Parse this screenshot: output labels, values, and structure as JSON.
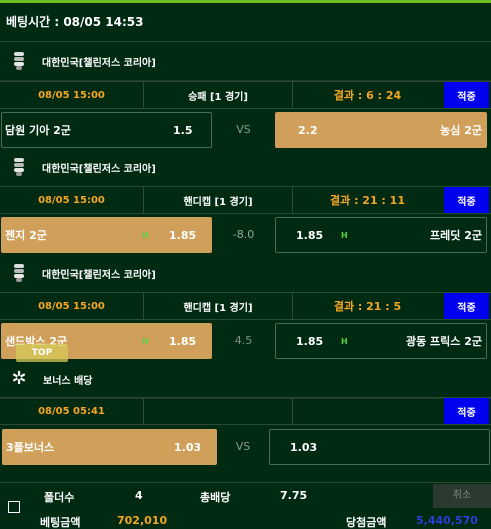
{
  "header": {
    "bet_time": "베팅시간 : 08/05 14:53"
  },
  "bets": [
    {
      "league": "대한민국[챌린저스 코리아]",
      "date": "08/05 15:00",
      "type": "승패 [1 경기]",
      "result": "결과 : 6 : 24",
      "status": "적중",
      "home": {
        "team": "담원 기아 2군",
        "odds": "1.5"
      },
      "middle": "VS",
      "away": {
        "team": "농심 2군",
        "odds": "2.2"
      }
    },
    {
      "league": "대한민국[챌린저스 코리아]",
      "date": "08/05 15:00",
      "type": "핸디캡 [1 경기]",
      "result": "결과 : 21 : 11",
      "status": "적중",
      "home": {
        "team": "젠지 2군",
        "odds": "1.85",
        "mark": "H"
      },
      "middle": "-8.0",
      "away": {
        "team": "프레딧 2군",
        "odds": "1.85",
        "mark": "H"
      }
    },
    {
      "league": "대한민국[챌린저스 코리아]",
      "date": "08/05 15:00",
      "type": "핸디캡 [1 경기]",
      "result": "결과 : 21 : 5",
      "status": "적중",
      "home": {
        "team": "샌드박스 2군",
        "odds": "1.85",
        "mark": "H"
      },
      "middle": "4.5",
      "away": {
        "team": "광동 프릭스 2군",
        "odds": "1.85",
        "mark": "H"
      }
    },
    {
      "league": "보너스 배당",
      "date": "08/05 05:41",
      "type": "",
      "result": "",
      "status": "적중",
      "home": {
        "team": "3폴보너스",
        "odds": "1.03"
      },
      "middle": "VS",
      "away": {
        "team": "",
        "odds": "1.03"
      }
    }
  ],
  "top_button": "TOP",
  "footer": {
    "folder_label": "폴더수",
    "folder_count": "4",
    "total_odds_label": "총배당",
    "total_odds": "7.75",
    "cancel": "취소",
    "bet_amount_label": "베팅금액",
    "bet_amount": "702,010",
    "win_amount_label": "당첨금액",
    "win_amount": "5,440,570"
  },
  "colors": {
    "background": "#012a12",
    "selected_box": "#d09f5a",
    "accent_orange": "#f5a623",
    "status_blue": "#0000ee",
    "handicap_mark": "#5bd14a",
    "win_amount": "#2a3fd6"
  }
}
